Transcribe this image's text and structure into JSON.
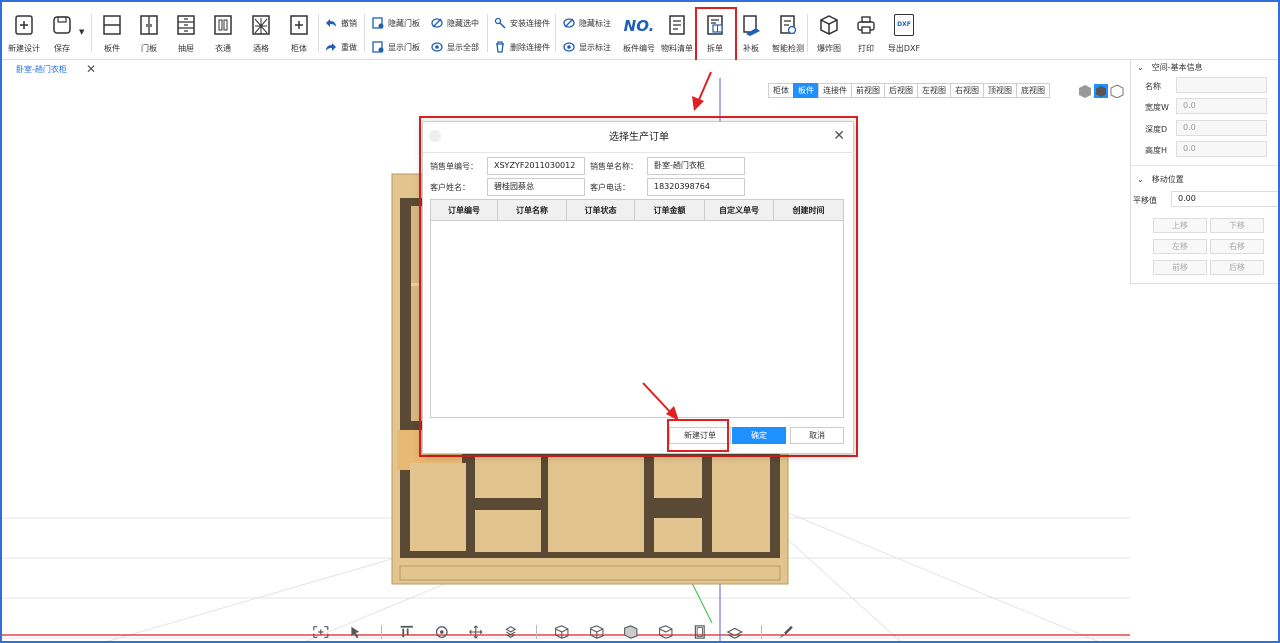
{
  "toolbar": {
    "new_design": "新建设计",
    "save": "保存",
    "panel": "板件",
    "door_panel": "门板",
    "drawer": "抽屉",
    "wardrobe_rail": "衣通",
    "wine_rack": "酒格",
    "cabinet": "柜体",
    "undo": "撤销",
    "redo": "重做",
    "hide_door": "隐藏门板",
    "show_door": "显示门板",
    "hide_selected": "隐藏选中",
    "show_all": "显示全部",
    "install_connector": "安装连接件",
    "delete_connector": "删除连接件",
    "hide_label": "隐藏标注",
    "show_label": "显示标注",
    "no_icon_text": "NO.",
    "panel_number": "板件编号",
    "material_list": "物料清单",
    "split_order": "拆单",
    "supplement": "补板",
    "smart_check": "智能检测",
    "exploded_view": "爆炸图",
    "print": "打印",
    "dxf_icon_text": "DXF",
    "export_dxf": "导出DXF"
  },
  "tab": {
    "label": "卧室-趟门衣柜",
    "close": "✕"
  },
  "views": [
    "柜体",
    "板件",
    "连接件",
    "前视图",
    "后视图",
    "左视图",
    "右视图",
    "顶视图",
    "底视图"
  ],
  "active_view": "板件",
  "panel": {
    "section1": "空间-基本信息",
    "name_label": "名称",
    "width_label": "宽度W",
    "width_value": "0.0",
    "depth_label": "深度D",
    "depth_value": "0.0",
    "height_label": "高度H",
    "height_value": "0.0",
    "section2": "移动位置",
    "offset_label": "平移值",
    "offset_value": "0.00",
    "up": "上移",
    "down": "下移",
    "left": "左移",
    "right": "右移",
    "front": "前移",
    "back": "后移"
  },
  "dialog": {
    "title": "选择生产订单",
    "close": "✕",
    "sales_no_label": "销售单编号：",
    "sales_no_value": "XSYZYF2011030012",
    "sales_name_label": "销售单名称：",
    "sales_name_value": "卧室-趟门衣柜",
    "customer_label": "客户姓名：",
    "customer_value": "碧桂园蔡总",
    "phone_label": "客户电话：",
    "phone_value": "18320398764",
    "columns": [
      "订单编号",
      "订单名称",
      "订单状态",
      "订单金额",
      "自定义单号",
      "创建时间"
    ],
    "new_order": "新建订单",
    "confirm": "确定",
    "cancel": "取消"
  },
  "colors": {
    "accent": "#1e90ff",
    "annotation": "#e02020",
    "wood": "#e2c48e",
    "frame": "#5a4a35"
  }
}
